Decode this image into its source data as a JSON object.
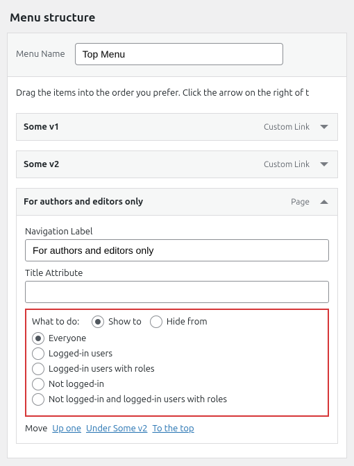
{
  "heading": "Menu structure",
  "menu_name_label": "Menu Name",
  "menu_name_value": "Top Menu",
  "instructions": "Drag the items into the order you prefer. Click the arrow on the right of t",
  "items": [
    {
      "title": "Some v1",
      "type": "Custom Link",
      "expanded": false
    },
    {
      "title": "Some v2",
      "type": "Custom Link",
      "expanded": false
    }
  ],
  "expanded_item": {
    "title": "For authors and editors only",
    "type": "Page",
    "nav_label_field": "Navigation Label",
    "nav_label_value": "For authors and editors only",
    "title_attr_field": "Title Attribute",
    "title_attr_value": ""
  },
  "visibility": {
    "what_to_do_label": "What to do:",
    "modes": [
      {
        "label": "Show to",
        "checked": true
      },
      {
        "label": "Hide from",
        "checked": false
      }
    ],
    "audiences": [
      {
        "label": "Everyone",
        "checked": true
      },
      {
        "label": "Logged-in users",
        "checked": false
      },
      {
        "label": "Logged-in users with roles",
        "checked": false
      },
      {
        "label": "Not logged-in",
        "checked": false
      },
      {
        "label": "Not logged-in and logged-in users with roles",
        "checked": false
      }
    ]
  },
  "move": {
    "label": "Move",
    "links": [
      "Up one",
      "Under Some v2",
      "To the top"
    ]
  }
}
